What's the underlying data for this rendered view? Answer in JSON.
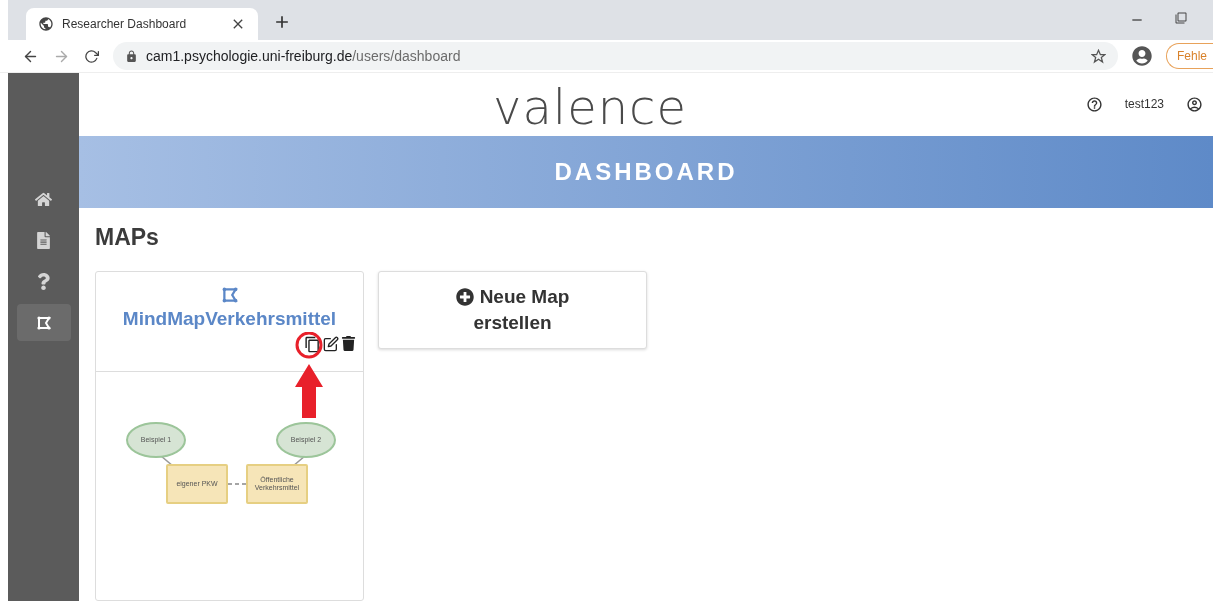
{
  "browser": {
    "tab_title": "Researcher Dashboard",
    "url_host": "cam1.psychologie.uni-freiburg.de",
    "url_path": "/users/dashboard",
    "profile_button": "Fehle"
  },
  "sidebar": {
    "items": [
      {
        "kind": "home",
        "selected": false
      },
      {
        "kind": "document",
        "selected": false
      },
      {
        "kind": "help",
        "selected": false
      },
      {
        "kind": "map",
        "selected": true
      }
    ]
  },
  "header": {
    "logo": "valence",
    "username": "test123"
  },
  "banner": {
    "title": "DASHBOARD"
  },
  "section": {
    "title": "MAPs"
  },
  "map_card": {
    "title": "MindMapVerkehrsmittel",
    "annotation": true,
    "thumbnail": {
      "ovals": [
        "Beispiel 1",
        "Beispiel 2"
      ],
      "boxes": [
        "eigener PKW",
        "Öffentliche Verkehrsmittel"
      ]
    }
  },
  "new_map_button": {
    "label_line1": "Neue Map",
    "label_line2": "erstellen"
  }
}
